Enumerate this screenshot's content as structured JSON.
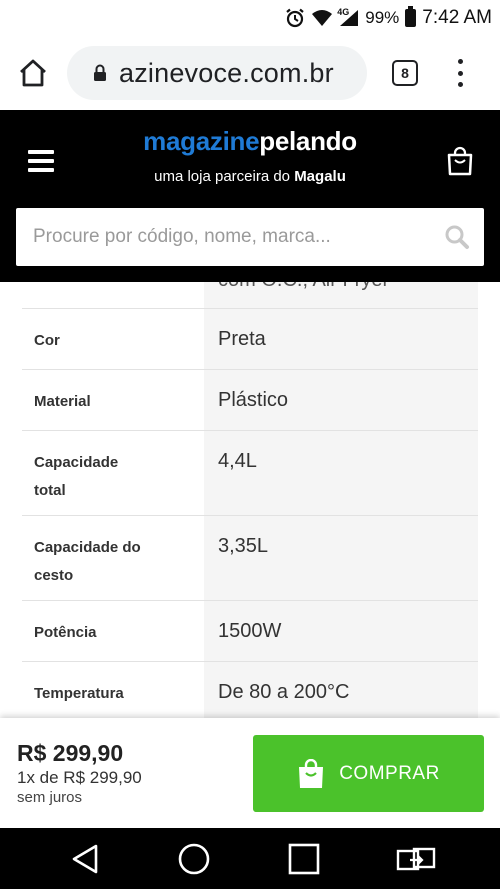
{
  "status_bar": {
    "network": "4G",
    "battery": "99%",
    "time": "7:42 AM"
  },
  "browser": {
    "url": "azinevoce.com.br",
    "tab_count": "8"
  },
  "site": {
    "logo_part1": "magazine",
    "logo_part2": "pelando",
    "tagline_prefix": "uma loja parceira do ",
    "tagline_brand": "Magalu",
    "search_placeholder": "Procure por código, nome, marca..."
  },
  "specs": {
    "cut_value": "com O.C., Air Fryer",
    "rows": [
      {
        "key": "Cor",
        "value": "Preta"
      },
      {
        "key": "Material",
        "value": "Plástico"
      },
      {
        "key": "Capacidade total",
        "value": "4,4L"
      },
      {
        "key": "Capacidade do cesto",
        "value": "3,35L"
      },
      {
        "key": "Potência",
        "value": "1500W"
      },
      {
        "key": "Temperatura",
        "value": "De 80 a 200°C"
      }
    ]
  },
  "buy": {
    "price": "R$ 299,90",
    "installments": "1x de R$ 299,90",
    "no_interest": "sem juros",
    "button_label": "COMPRAR"
  },
  "colors": {
    "brand_blue": "#1f7bd6",
    "buy_green": "#4bc22b",
    "header_bg": "#000000"
  }
}
